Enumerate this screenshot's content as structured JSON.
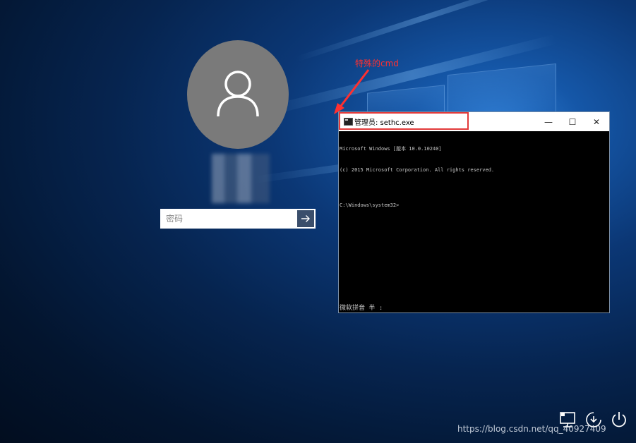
{
  "annotation": {
    "label": "特殊的cmd",
    "color": "#ff3030"
  },
  "login": {
    "password_placeholder": "密码",
    "submit_icon": "arrow-right-icon"
  },
  "cmd": {
    "title": "管理员: sethc.exe",
    "controls": {
      "minimize": "—",
      "maximize": "☐",
      "close": "✕"
    },
    "lines": [
      "Microsoft Windows [版本 10.0.10240]",
      "(c) 2015 Microsoft Corporation. All rights reserved.",
      "",
      "C:\\Windows\\system32>"
    ],
    "ime_status": "微软拼音 半 :"
  },
  "tray": {
    "icons": [
      "network-icon",
      "ease-of-access-icon",
      "power-icon"
    ]
  },
  "watermark": "https://blog.csdn.net/qq_40927409",
  "colors": {
    "highlight": "#e23a3a",
    "submit_bg": "#3a4e6b",
    "avatar_bg": "#7a7a7a"
  }
}
